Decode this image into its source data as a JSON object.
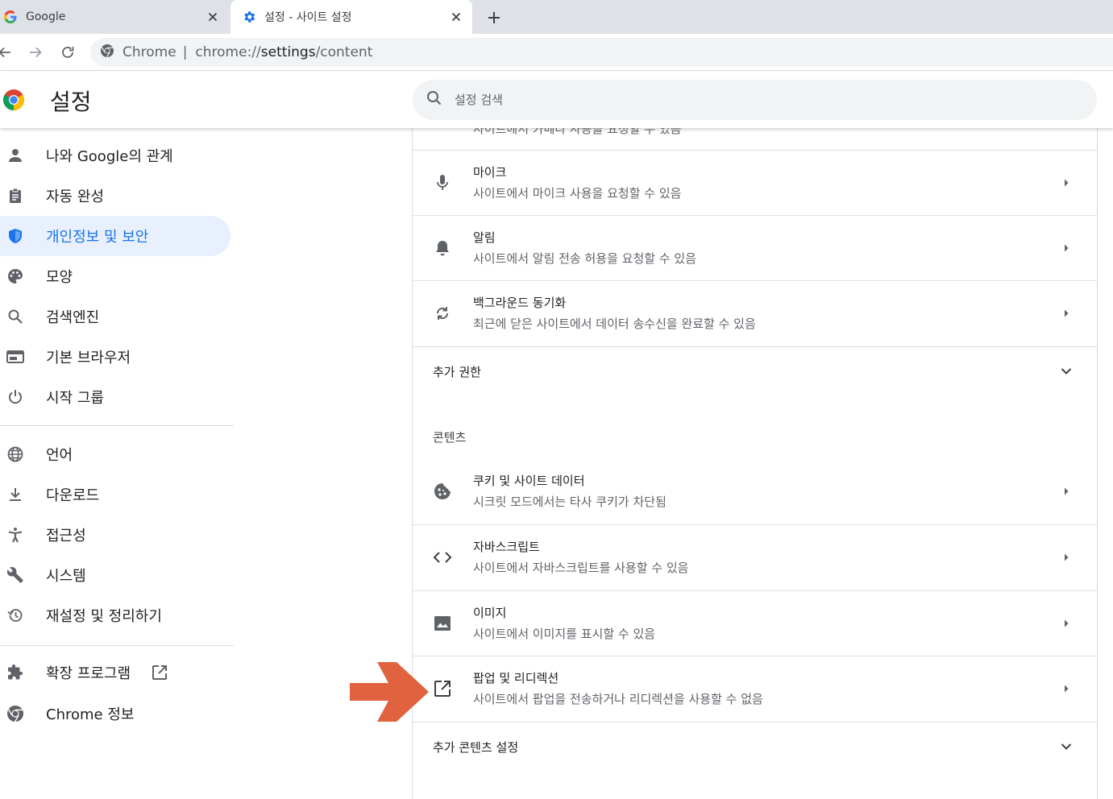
{
  "browser": {
    "tabs": [
      {
        "title": "Google",
        "favicon": "google-g-icon",
        "active": false
      },
      {
        "title": "설정 - 사이트 설정",
        "favicon": "gear-icon",
        "active": true
      }
    ],
    "address": {
      "chip": "Chrome",
      "url_scheme": "chrome://",
      "url_host": "settings",
      "url_path": "/content"
    }
  },
  "header": {
    "title": "설정",
    "search_placeholder": "설정 검색"
  },
  "sidebar": {
    "items": [
      {
        "label": "나와 Google의 관계",
        "icon": "person-icon",
        "active": false
      },
      {
        "label": "자동 완성",
        "icon": "clipboard-icon",
        "active": false
      },
      {
        "label": "개인정보 및 보안",
        "icon": "shield-icon",
        "active": true
      },
      {
        "label": "모양",
        "icon": "palette-icon",
        "active": false
      },
      {
        "label": "검색엔진",
        "icon": "search-icon",
        "active": false
      },
      {
        "label": "기본 브라우저",
        "icon": "browser-icon",
        "active": false
      },
      {
        "label": "시작 그룹",
        "icon": "power-icon",
        "active": false
      },
      {
        "label": "언어",
        "icon": "globe-icon",
        "active": false
      },
      {
        "label": "다운로드",
        "icon": "download-icon",
        "active": false
      },
      {
        "label": "접근성",
        "icon": "accessibility-icon",
        "active": false
      },
      {
        "label": "시스템",
        "icon": "wrench-icon",
        "active": false
      },
      {
        "label": "재설정 및 정리하기",
        "icon": "history-icon",
        "active": false
      },
      {
        "label": "확장 프로그램",
        "icon": "puzzle-icon",
        "active": false
      },
      {
        "label": "Chrome 정보",
        "icon": "chrome-icon",
        "active": false
      }
    ]
  },
  "main": {
    "cut_text": "사이트에서 카메라 사용을 요청할 수 있음",
    "permission_rows": [
      {
        "title": "마이크",
        "subtitle": "사이트에서 마이크 사용을 요청할 수 있음",
        "icon": "microphone-icon"
      },
      {
        "title": "알림",
        "subtitle": "사이트에서 알림 전송 허용을 요청할 수 있음",
        "icon": "bell-icon"
      },
      {
        "title": "백그라운드 동기화",
        "subtitle": "최근에 닫은 사이트에서 데이터 송수신을 완료할 수 있음",
        "icon": "sync-icon"
      }
    ],
    "more_permissions": "추가 권한",
    "content_heading": "콘텐츠",
    "content_rows": [
      {
        "title": "쿠키 및 사이트 데이터",
        "subtitle": "시크릿 모드에서는 타사 쿠키가 차단됨",
        "icon": "cookie-icon"
      },
      {
        "title": "자바스크립트",
        "subtitle": "사이트에서 자바스크립트를 사용할 수 있음",
        "icon": "code-icon"
      },
      {
        "title": "이미지",
        "subtitle": "사이트에서 이미지를 표시할 수 있음",
        "icon": "image-icon"
      },
      {
        "title": "팝업 및 리디렉션",
        "subtitle": "사이트에서 팝업을 전송하거나 리디렉션을 사용할 수 없음",
        "icon": "open-in-new-icon"
      }
    ],
    "more_content": "추가 콘텐츠 설정"
  },
  "colors": {
    "accent": "#1a73e8",
    "active_bg": "#e8f0fe",
    "annotation_arrow": "#e0623f"
  }
}
